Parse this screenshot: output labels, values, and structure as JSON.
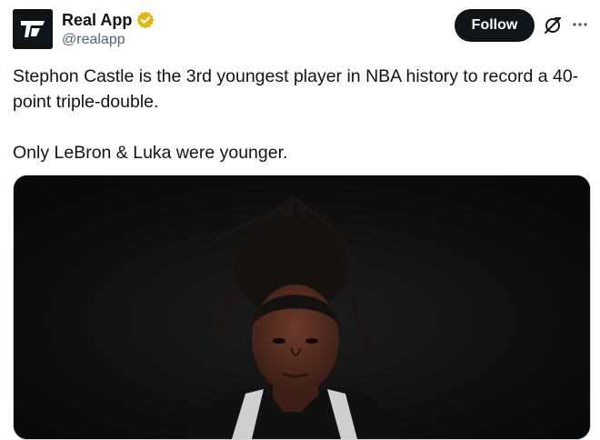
{
  "account": {
    "display_name": "Real App",
    "handle": "@realapp",
    "verified": true,
    "verified_color": "#e2b719"
  },
  "actions": {
    "follow_label": "Follow"
  },
  "tweet": {
    "paragraphs": [
      "Stephon Castle is the 3rd youngest player in NBA history to record a 40-point triple-double.",
      "Only LeBron & Luka were younger."
    ]
  },
  "media": {
    "type": "photo",
    "subject": "basketball-player-portrait"
  },
  "icons": [
    "avatar-logo-icon",
    "verified-badge-icon",
    "grok-icon",
    "more-options-icon"
  ],
  "colors": {
    "text_primary": "#0f1419",
    "text_secondary": "#536471",
    "follow_bg": "#0f1419",
    "follow_text": "#ffffff"
  }
}
